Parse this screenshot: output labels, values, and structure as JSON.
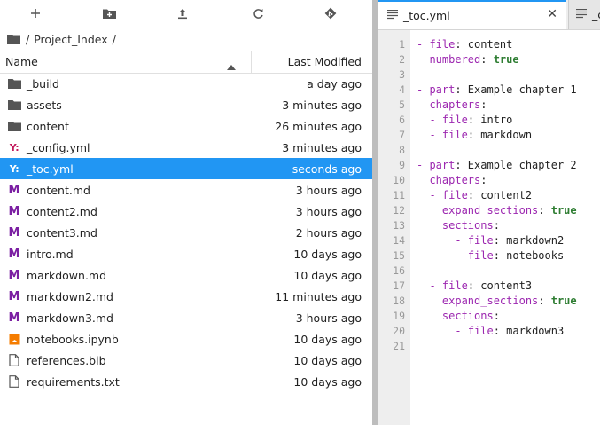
{
  "toolbar": {
    "buttons": [
      {
        "name": "new-launcher-button",
        "icon": "plus-icon"
      },
      {
        "name": "new-folder-button",
        "icon": "folder-plus-icon"
      },
      {
        "name": "upload-button",
        "icon": "upload-icon"
      },
      {
        "name": "refresh-button",
        "icon": "refresh-icon"
      },
      {
        "name": "git-clone-button",
        "icon": "git-icon"
      }
    ]
  },
  "breadcrumb": {
    "root": "/",
    "folder": "Project_Index",
    "trail": "/"
  },
  "file_browser": {
    "headers": {
      "name": "Name",
      "modified": "Last Modified"
    },
    "files": [
      {
        "name": "_build",
        "modified": "a day ago",
        "type": "folder"
      },
      {
        "name": "assets",
        "modified": "3 minutes ago",
        "type": "folder"
      },
      {
        "name": "content",
        "modified": "26 minutes ago",
        "type": "folder"
      },
      {
        "name": "_config.yml",
        "modified": "3 minutes ago",
        "type": "yaml"
      },
      {
        "name": "_toc.yml",
        "modified": "seconds ago",
        "type": "yaml",
        "selected": true
      },
      {
        "name": "content.md",
        "modified": "3 hours ago",
        "type": "markdown"
      },
      {
        "name": "content2.md",
        "modified": "3 hours ago",
        "type": "markdown"
      },
      {
        "name": "content3.md",
        "modified": "2 hours ago",
        "type": "markdown"
      },
      {
        "name": "intro.md",
        "modified": "10 days ago",
        "type": "markdown"
      },
      {
        "name": "markdown.md",
        "modified": "10 days ago",
        "type": "markdown"
      },
      {
        "name": "markdown2.md",
        "modified": "11 minutes ago",
        "type": "markdown"
      },
      {
        "name": "markdown3.md",
        "modified": "3 hours ago",
        "type": "markdown"
      },
      {
        "name": "notebooks.ipynb",
        "modified": "10 days ago",
        "type": "notebook"
      },
      {
        "name": "references.bib",
        "modified": "10 days ago",
        "type": "file"
      },
      {
        "name": "requirements.txt",
        "modified": "10 days ago",
        "type": "file"
      }
    ]
  },
  "tabs": [
    {
      "label": "_toc.yml",
      "active": true
    },
    {
      "label": "_c",
      "active": false
    }
  ],
  "editor": {
    "lines": [
      {
        "n": "1",
        "parts": [
          [
            "d",
            "- "
          ],
          [
            "k",
            "file"
          ],
          [
            "v",
            ": content"
          ]
        ]
      },
      {
        "n": "2",
        "parts": [
          [
            "v",
            "  "
          ],
          [
            "k",
            "numbered"
          ],
          [
            "v",
            ": "
          ],
          [
            "t",
            "true"
          ]
        ]
      },
      {
        "n": "3",
        "parts": []
      },
      {
        "n": "4",
        "parts": [
          [
            "d",
            "- "
          ],
          [
            "k",
            "part"
          ],
          [
            "v",
            ": Example chapter 1"
          ]
        ]
      },
      {
        "n": "5",
        "parts": [
          [
            "v",
            "  "
          ],
          [
            "k",
            "chapters"
          ],
          [
            "v",
            ":"
          ]
        ]
      },
      {
        "n": "6",
        "parts": [
          [
            "v",
            "  "
          ],
          [
            "d",
            "- "
          ],
          [
            "k",
            "file"
          ],
          [
            "v",
            ": intro"
          ]
        ]
      },
      {
        "n": "7",
        "parts": [
          [
            "v",
            "  "
          ],
          [
            "d",
            "- "
          ],
          [
            "k",
            "file"
          ],
          [
            "v",
            ": markdown"
          ]
        ]
      },
      {
        "n": "8",
        "parts": []
      },
      {
        "n": "9",
        "parts": [
          [
            "d",
            "- "
          ],
          [
            "k",
            "part"
          ],
          [
            "v",
            ": Example chapter 2"
          ]
        ]
      },
      {
        "n": "10",
        "parts": [
          [
            "v",
            "  "
          ],
          [
            "k",
            "chapters"
          ],
          [
            "v",
            ":"
          ]
        ]
      },
      {
        "n": "11",
        "parts": [
          [
            "v",
            "  "
          ],
          [
            "d",
            "- "
          ],
          [
            "k",
            "file"
          ],
          [
            "v",
            ": content2"
          ]
        ]
      },
      {
        "n": "12",
        "parts": [
          [
            "v",
            "    "
          ],
          [
            "k",
            "expand_sections"
          ],
          [
            "v",
            ": "
          ],
          [
            "t",
            "true"
          ]
        ]
      },
      {
        "n": "13",
        "parts": [
          [
            "v",
            "    "
          ],
          [
            "k",
            "sections"
          ],
          [
            "v",
            ":"
          ]
        ]
      },
      {
        "n": "14",
        "parts": [
          [
            "v",
            "      "
          ],
          [
            "d",
            "- "
          ],
          [
            "k",
            "file"
          ],
          [
            "v",
            ": markdown2"
          ]
        ]
      },
      {
        "n": "15",
        "parts": [
          [
            "v",
            "      "
          ],
          [
            "d",
            "- "
          ],
          [
            "k",
            "file"
          ],
          [
            "v",
            ": notebooks"
          ]
        ]
      },
      {
        "n": "16",
        "parts": []
      },
      {
        "n": "17",
        "parts": [
          [
            "v",
            "  "
          ],
          [
            "d",
            "- "
          ],
          [
            "k",
            "file"
          ],
          [
            "v",
            ": content3"
          ]
        ]
      },
      {
        "n": "18",
        "parts": [
          [
            "v",
            "    "
          ],
          [
            "k",
            "expand_sections"
          ],
          [
            "v",
            ": "
          ],
          [
            "t",
            "true"
          ]
        ]
      },
      {
        "n": "19",
        "parts": [
          [
            "v",
            "    "
          ],
          [
            "k",
            "sections"
          ],
          [
            "v",
            ":"
          ]
        ]
      },
      {
        "n": "20",
        "parts": [
          [
            "v",
            "      "
          ],
          [
            "d",
            "- "
          ],
          [
            "k",
            "file"
          ],
          [
            "v",
            ": markdown3"
          ]
        ]
      },
      {
        "n": "21",
        "parts": []
      }
    ]
  },
  "colors": {
    "selection": "#2196f3",
    "yaml_icon": "#c2185b",
    "markdown_icon": "#7b1fa2",
    "notebook_icon": "#f57c00",
    "key": "#9c27b0",
    "bool": "#2e7d32"
  }
}
